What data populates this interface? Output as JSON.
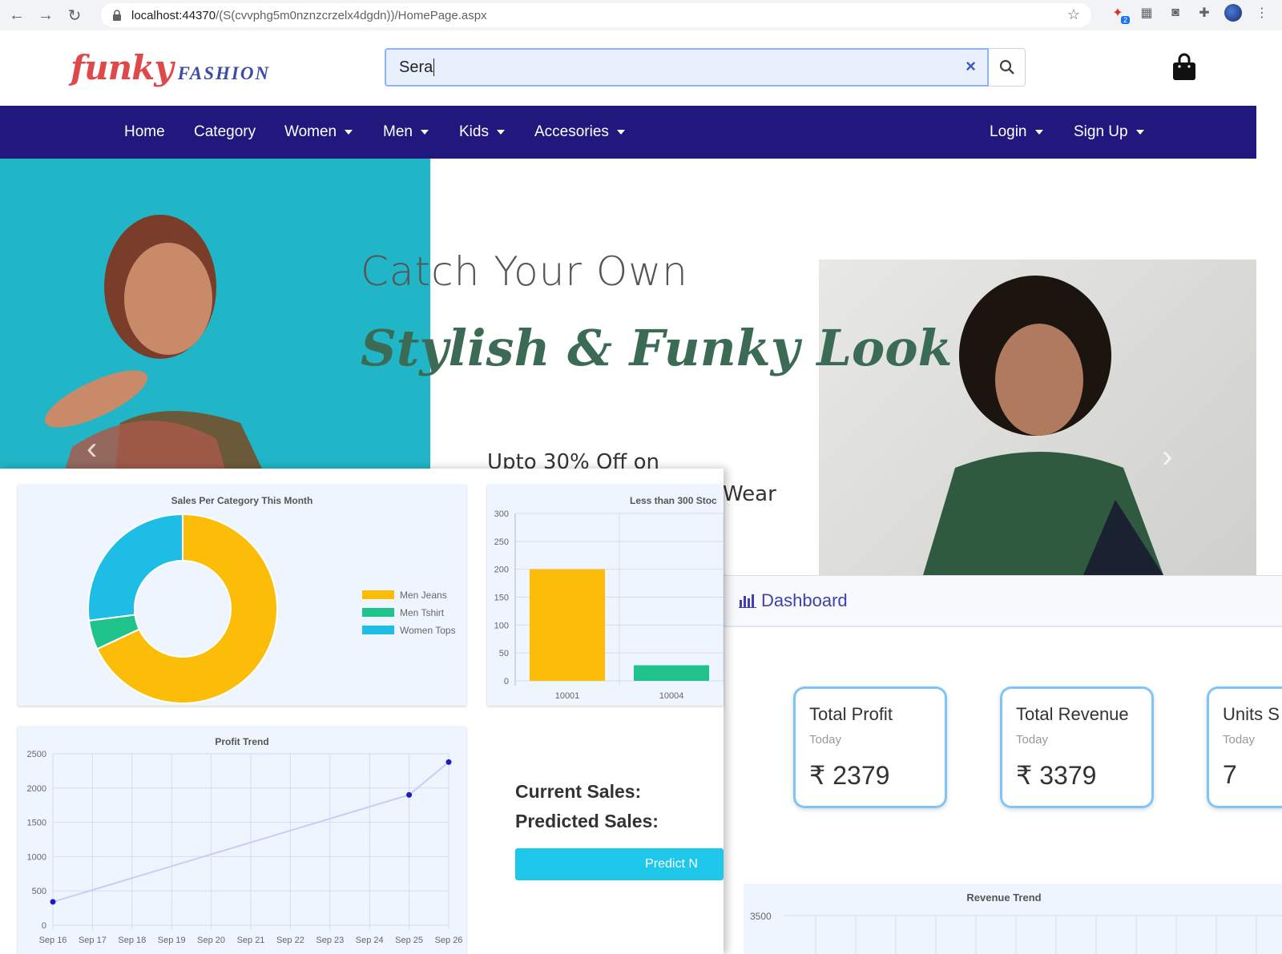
{
  "browser": {
    "url_host": "localhost:44370",
    "url_path": "/(S(cvvphg5m0nznzcrzelx4dgdn))/HomePage.aspx"
  },
  "site": {
    "logo_primary": "funky",
    "logo_secondary": "FASHION",
    "search_value": "Sera",
    "nav": {
      "home": "Home",
      "category": "Category",
      "women": "Women",
      "men": "Men",
      "kids": "Kids",
      "accesories": "Accesories",
      "login": "Login",
      "signup": "Sign Up"
    }
  },
  "hero": {
    "line1": "Catch Your Own",
    "line2": "Stylish & Funky Look",
    "line3": "Upto 30% Off on",
    "line4": "Wear"
  },
  "dashboard": {
    "title": "Dashboard",
    "kpis": [
      {
        "title": "Total Profit",
        "sub": "Today",
        "value": "₹ 2379"
      },
      {
        "title": "Total Revenue",
        "sub": "Today",
        "value": "₹ 3379"
      },
      {
        "title": "Units S",
        "sub": "Today",
        "value": "7"
      }
    ],
    "revenue_trend_title": "Revenue Trend",
    "revenue_trend_tick": "3500"
  },
  "analytics": {
    "current_sales_label": "Current Sales:",
    "predicted_sales_label": "Predicted Sales:",
    "predict_button": "Predict N"
  },
  "chart_data": [
    {
      "type": "pie",
      "title": "Sales Per Category This Month",
      "categories": [
        "Men Jeans",
        "Men Tshirt",
        "Women Tops"
      ],
      "values": [
        68,
        5,
        27
      ],
      "colors": [
        "#fbbd08",
        "#21c38d",
        "#1ebde6"
      ],
      "legend": "right"
    },
    {
      "type": "bar",
      "title": "Less than 300 Stoc",
      "categories": [
        "10001",
        "10004"
      ],
      "values": [
        200,
        28
      ],
      "colors": [
        "#fbbd08",
        "#21c38d"
      ],
      "ylim": [
        0,
        300
      ],
      "yticks": [
        0,
        50,
        100,
        150,
        200,
        250,
        300
      ]
    },
    {
      "type": "line",
      "title": "Profit Trend",
      "categories": [
        "Sep 16",
        "Sep 17",
        "Sep 18",
        "Sep 19",
        "Sep 20",
        "Sep 21",
        "Sep 22",
        "Sep 23",
        "Sep 24",
        "Sep 25",
        "Sep 26"
      ],
      "points": [
        {
          "x": "Sep 16",
          "y": 340
        },
        {
          "x": "Sep 25",
          "y": 1900
        },
        {
          "x": "Sep 26",
          "y": 2379
        }
      ],
      "ylim": [
        0,
        2500
      ],
      "yticks": [
        0,
        500,
        1000,
        1500,
        2000,
        2500
      ],
      "color": "#1a1ac8"
    }
  ]
}
